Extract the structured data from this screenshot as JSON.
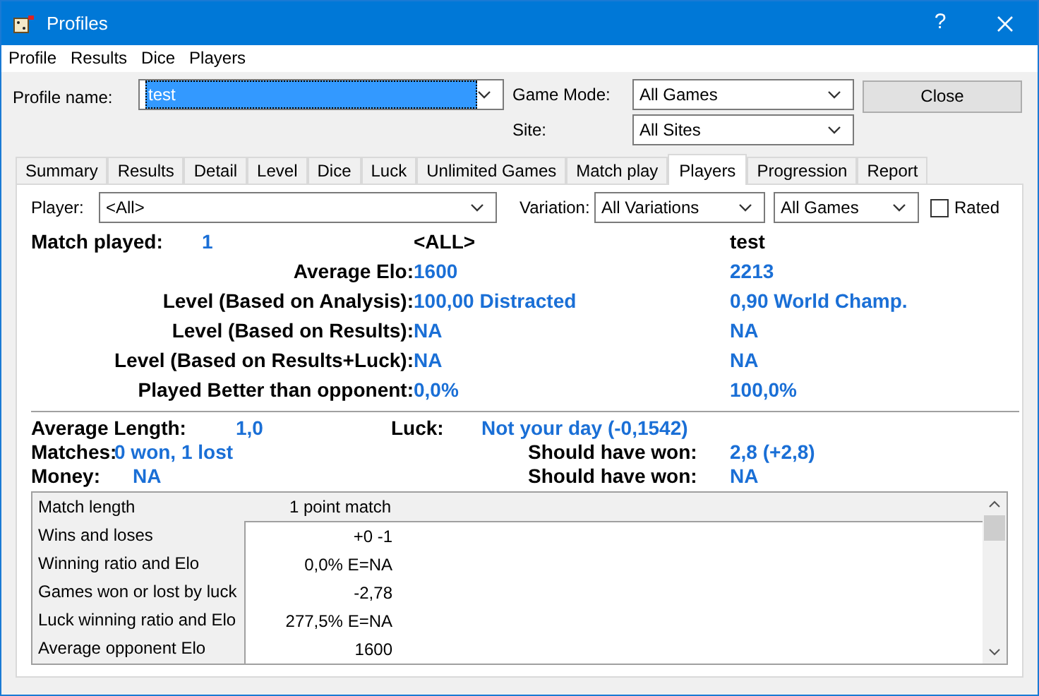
{
  "window": {
    "title": "Profiles",
    "help": "?"
  },
  "menu": [
    "Profile",
    "Results",
    "Dice",
    "Players"
  ],
  "profile": {
    "label": "Profile name:",
    "value": "test"
  },
  "game_mode": {
    "label": "Game Mode:",
    "value": "All Games"
  },
  "site": {
    "label": "Site:",
    "value": "All Sites"
  },
  "close_button": "Close",
  "tabs": [
    {
      "label": "Summary",
      "selected": false
    },
    {
      "label": "Results",
      "selected": false
    },
    {
      "label": "Detail",
      "selected": false
    },
    {
      "label": "Level",
      "selected": false
    },
    {
      "label": "Dice",
      "selected": false
    },
    {
      "label": "Luck",
      "selected": false
    },
    {
      "label": "Unlimited Games",
      "selected": false
    },
    {
      "label": "Match play",
      "selected": false
    },
    {
      "label": "Players",
      "selected": true
    },
    {
      "label": "Progression",
      "selected": false
    },
    {
      "label": "Report",
      "selected": false
    }
  ],
  "filters": {
    "player_label": "Player:",
    "player": "<All>",
    "variation_label": "Variation:",
    "variation": "All Variations",
    "games": "All Games",
    "rated": {
      "label": "Rated",
      "checked": false
    }
  },
  "summary": {
    "match_played_label": "Match played:",
    "match_played": "1",
    "column_1": "<ALL>",
    "column_2": "test"
  },
  "stats": [
    {
      "label": "Average Elo:",
      "value_1": "1600",
      "value_2": "2213"
    },
    {
      "label": "Level (Based on Analysis):",
      "value_1": "100,00 Distracted",
      "value_2": "0,90 World Champ."
    },
    {
      "label": "Level (Based on Results):",
      "value_1": "NA",
      "value_2": "NA"
    },
    {
      "label": "Level (Based on Results+Luck):",
      "value_1": "NA",
      "value_2": "NA"
    },
    {
      "label": "Played Better than opponent:",
      "value_1": "0,0%",
      "value_2": "100,0%"
    }
  ],
  "totals": {
    "average_length_label": "Average Length:",
    "average_length": "1,0",
    "luck_label": "Luck:",
    "luck": "Not your day (-0,1542)",
    "matches_label": "Matches:",
    "matches": "0 won, 1 lost",
    "should_have_won_label": "Should have won:",
    "should_have_won": "2,8 (+2,8)",
    "money_label": "Money:",
    "money": "NA",
    "money_should_have_won_label": "Should have won:",
    "money_should_have_won": "NA"
  },
  "table": {
    "header": {
      "label": "Match length",
      "value": "1 point match"
    },
    "rows": [
      {
        "label": "Wins and loses",
        "value": "+0 -1"
      },
      {
        "label": "Winning ratio and Elo",
        "value": "0,0% E=NA"
      },
      {
        "label": "Games won or lost by luck",
        "value": "-2,78"
      },
      {
        "label": "Luck winning ratio and Elo",
        "value": "277,5% E=NA"
      },
      {
        "label": "Average opponent Elo",
        "value": "1600"
      }
    ]
  }
}
